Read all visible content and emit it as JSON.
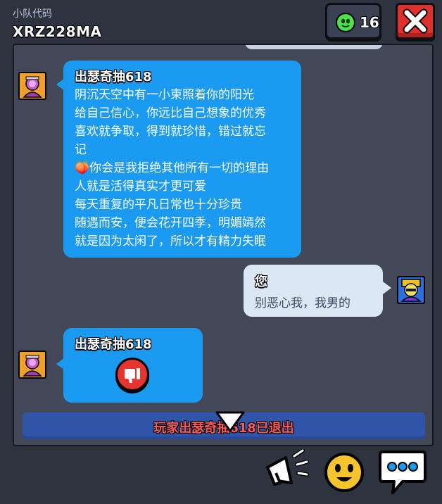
{
  "header": {
    "team_label": "小队代码",
    "team_code": "XRZ228MA",
    "online_count": "16"
  },
  "messages": [
    {
      "sender": "出瑟奇抽618",
      "lines": [
        "阴沉天空中有一小束照着你的阳光",
        "给自己信心，你远比自己想象的优秀",
        "喜欢就争取，得到就珍惜，错过就忘",
        "记",
        "🍑你会是我拒绝其他所有一切的理由",
        "人就是活得真实才更可爱",
        "每天重复的平凡日常也十分珍贵",
        "随遇而安，便会花开四季，明媚嫣然",
        "就是因为太闲了，所以才有精力失眠"
      ]
    },
    {
      "sender": "您",
      "text": "别恶心我，我男的"
    },
    {
      "sender": "出瑟奇抽618",
      "reaction": "thumbs-down"
    }
  ],
  "system": {
    "text": "玩家出瑟奇抽618已退出"
  },
  "icons": {
    "close": "close-icon",
    "counter": "smiley-icon",
    "megaphone": "megaphone-icon",
    "emote": "emote-icon",
    "chat": "chat-icon"
  },
  "colors": {
    "bubble_in": "#1a9af0",
    "bubble_out": "#dce7f4",
    "close": "#e0302d",
    "system_bar": "#2f54a8",
    "system_text": "#ff5a5a"
  }
}
